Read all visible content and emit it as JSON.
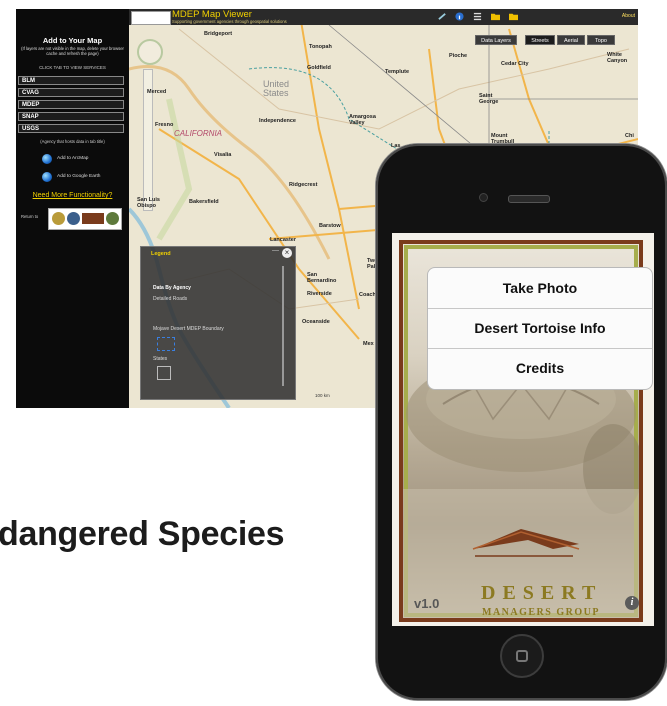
{
  "map_viewer": {
    "app_title": "MDEP Map Viewer",
    "app_subtitle": "Supporting government agencies through geospatial solutions",
    "about": "About",
    "left_panel": {
      "title": "Add to Your Map",
      "note": "(If layers are not visible in the map, delete your browser cache and refresh the page)",
      "tab_hint": "CLICK TAB TO VIEW SERVICES",
      "layers": [
        "BLM",
        "CVAG",
        "MDEP",
        "SNAP",
        "USGS"
      ],
      "agency_note": "(Agency that hosts data in tab title)",
      "add_arcmap": "Add to ArcMap",
      "add_google_earth": "Add to Google Earth",
      "need_more": "Need More Functionality?",
      "return_to": "Return to"
    },
    "basemaps": [
      "Data Layers",
      "Streets",
      "Aerial",
      "Topo"
    ],
    "map_labels": [
      "Bridgeport",
      "Tonopah",
      "Goldfield",
      "Pioche",
      "Cedar City",
      "White Canyon",
      "Templute",
      "Merced",
      "Fresno",
      "Independence",
      "Amargosa Valley",
      "Saint George",
      "Mount Trumbull",
      "Visalia",
      "Ridgecrest",
      "Las",
      "San Luis Obispo",
      "Bakersfield",
      "Barstow",
      "Lancaster",
      "Twentynine Palms",
      "San Bernardino",
      "Riverside",
      "Coachella",
      "Oceanside",
      "Mex",
      "Chi"
    ],
    "big_labels": [
      "United States",
      "CALIFORNIA"
    ],
    "legend": {
      "title": "Legend",
      "close": "×",
      "minimize": "—",
      "items": [
        "Data By Agency",
        "Detailed Roads",
        "Mojave Desert MDEP Boundary",
        "States"
      ]
    },
    "scale_label": "100 km"
  },
  "heading": "dangered Species",
  "phone_app": {
    "menu": [
      "Take Photo",
      "Desert Tortoise Info",
      "Credits"
    ],
    "version": "v1.0",
    "brand_line1": "DESERT",
    "brand_line2": "MANAGERS GROUP",
    "info": "i"
  },
  "colors": {
    "map_title": "#f0d000",
    "brand_gold": "#8c7a22",
    "frame_brown": "#7a3b1c",
    "frame_green": "#a6ad4c"
  },
  "icons": [
    "globe-icon",
    "compass-icon",
    "close-icon",
    "info-icon",
    "home-button-icon",
    "folder-icon"
  ]
}
